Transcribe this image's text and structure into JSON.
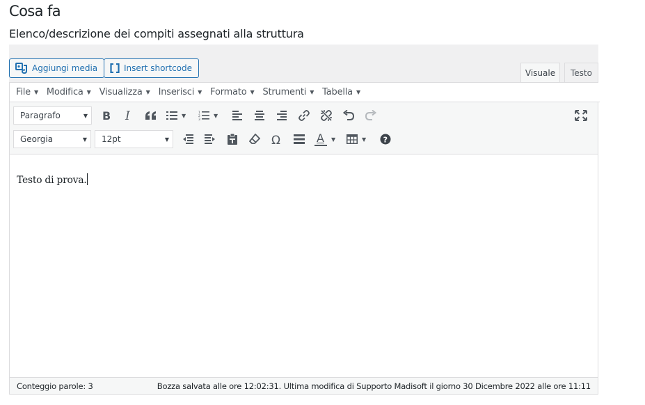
{
  "section": {
    "title": "Cosa fa",
    "description": "Elenco/descrizione dei compiti assegnati alla struttura"
  },
  "media_buttons": {
    "add_media": "Aggiungi media",
    "insert_shortcode": "Insert shortcode"
  },
  "tabs": {
    "visual": "Visuale",
    "text": "Testo"
  },
  "menubar": [
    {
      "label": "File"
    },
    {
      "label": "Modifica"
    },
    {
      "label": "Visualizza"
    },
    {
      "label": "Inserisci"
    },
    {
      "label": "Formato"
    },
    {
      "label": "Strumenti"
    },
    {
      "label": "Tabella"
    }
  ],
  "toolbar": {
    "block_format": "Paragrafo",
    "font_family": "Georgia",
    "font_size": "12pt",
    "text_color": "A",
    "colors": {
      "accent": "#2271b1",
      "icon": "#50575e",
      "help": "#3c434a"
    },
    "icons_row1": [
      "bold-icon",
      "italic-icon",
      "blockquote-icon",
      "bullet-list-icon",
      "numbered-list-icon",
      "align-left-icon",
      "align-center-icon",
      "align-right-icon",
      "link-icon",
      "unlink-icon",
      "undo-icon",
      "redo-icon",
      "fullscreen-icon"
    ],
    "icons_row2": [
      "outdent-icon",
      "indent-icon",
      "paste-text-icon",
      "clear-formatting-icon",
      "special-character-icon",
      "horizontal-line-icon",
      "text-color-icon",
      "table-icon",
      "help-icon"
    ]
  },
  "content": {
    "text": "Testo di prova."
  },
  "status": {
    "word_count": "Conteggio parole: 3",
    "save_status": "Bozza salvata alle ore 12:02:31. Ultima modifica di Supporto Madisoft il giorno 30 Dicembre 2022 alle ore 11:11"
  }
}
